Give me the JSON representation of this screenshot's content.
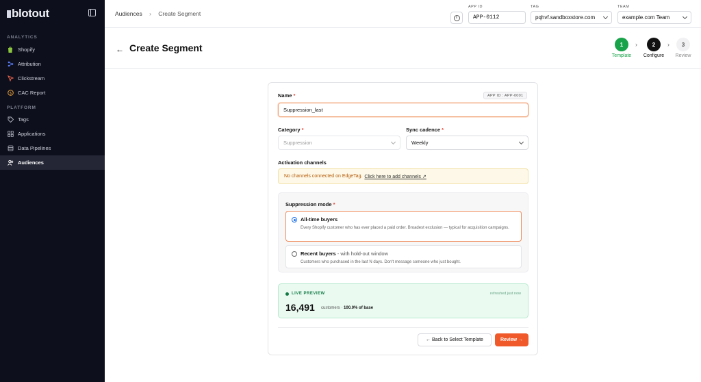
{
  "sidebar": {
    "brand": "blotout",
    "sections": [
      {
        "label": "ANALYTICS"
      },
      {
        "label": "PLATFORM"
      }
    ],
    "items": [
      {
        "label": "Shopify",
        "icon": "shopify-icon"
      },
      {
        "label": "Attribution",
        "icon": "attribution-icon"
      },
      {
        "label": "Clickstream",
        "icon": "clickstream-icon"
      },
      {
        "label": "CAC Report",
        "icon": "cac-report-icon"
      },
      {
        "label": "Tags",
        "icon": "tag-icon"
      },
      {
        "label": "Applications",
        "icon": "applications-icon"
      },
      {
        "label": "Data Pipelines",
        "icon": "database-icon"
      },
      {
        "label": "Audiences",
        "icon": "audiences-icon",
        "active": true
      }
    ]
  },
  "topbar": {
    "breadcrumb": {
      "root": "Audiences",
      "current": "Create Segment"
    },
    "app_id": {
      "label": "APP ID",
      "value": "APP-0112"
    },
    "tag": {
      "label": "TAG",
      "value": "pqhvf.sandboxstore.com"
    },
    "team": {
      "label": "TEAM",
      "value": "example.com Team"
    }
  },
  "header": {
    "title": "Create Segment",
    "steps": [
      {
        "num": "1",
        "label": "Template",
        "state": "done"
      },
      {
        "num": "2",
        "label": "Configure",
        "state": "current"
      },
      {
        "num": "3",
        "label": "Review",
        "state": "upcoming"
      }
    ]
  },
  "form": {
    "name_label": "Name",
    "app_id_badge": "APP ID : APP-0001",
    "name_value": "Suppression_last",
    "category_label": "Category",
    "category_value": "Suppression",
    "sync_label": "Sync cadence",
    "sync_value": "Weekly",
    "activation_label": "Activation channels",
    "activation_warning": "No channels connected on EdgeTag.",
    "activation_link": "Click here to add channels",
    "mode_label": "Suppression mode",
    "options": [
      {
        "title": "All-time buyers",
        "subtitle": "",
        "desc": "Every Shopify customer who has ever placed a paid order. Broadest exclusion — typical for acquisition campaigns.",
        "selected": true
      },
      {
        "title": "Recent buyers",
        "subtitle": " - with hold-out window",
        "desc": "Customers who purchased in the last N days. Don't message someone who just bought.",
        "selected": false
      }
    ],
    "preview": {
      "label": "LIVE PREVIEW",
      "refreshed": "refreshed just now",
      "count": "16,491",
      "unit": "customers · ",
      "share": "100.0% of base"
    },
    "back_button": "← Back to Select Template",
    "review_button": "Review →"
  },
  "colors": {
    "accent": "#f05a2a",
    "step_done": "#18a34a",
    "step_current": "#111111",
    "sidebar_bg": "#0d0f1c"
  }
}
